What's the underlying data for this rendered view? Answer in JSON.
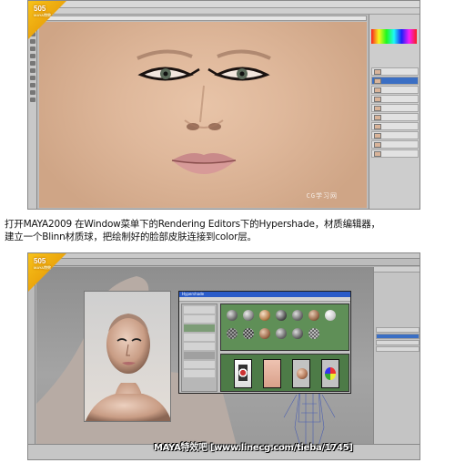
{
  "top_screenshot": {
    "logo": {
      "text": "505",
      "sub": "MAYA特效"
    },
    "doc_tab_label": "",
    "layers": [
      "",
      "",
      "",
      "",
      "",
      "",
      "",
      "",
      "",
      ""
    ],
    "watermark": "CG学习网"
  },
  "caption": {
    "line1": "打开MAYA2009 在Window菜单下的Rendering Editors下的Hypershade，材质编辑器，",
    "line2": "建立一个Blinn材质球，把绘制好的脸部皮肤连接到color层。"
  },
  "bottom_screenshot": {
    "logo": {
      "text": "505",
      "sub": "MAYA特效"
    },
    "hypershade_title": "Hypershade",
    "banner": "MAYA特效吧 [www.linecg.com/tieba/1745]"
  }
}
